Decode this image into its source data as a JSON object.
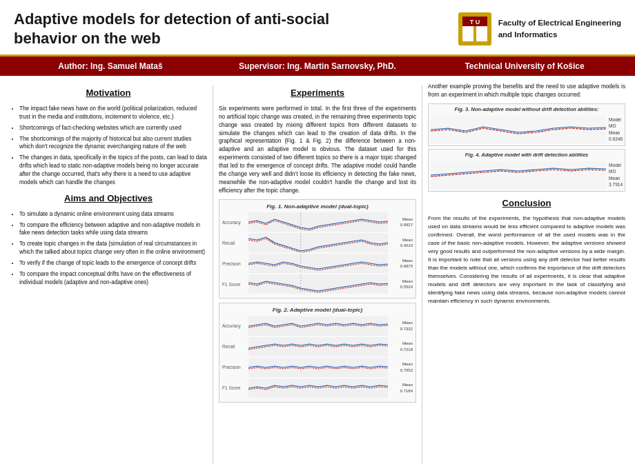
{
  "header": {
    "title_line1": "Adaptive models for detection of anti-social",
    "title_line2": "behavior on the web",
    "logo_text_line1": "Faculty of Electrical Engineering",
    "logo_text_line2": "and Informatics"
  },
  "author_bar": {
    "author": "Author: Ing. Samuel Mataš",
    "supervisor": "Supervisor: Ing. Martin Sarnovsky, PhD.",
    "university": "Technical University of Košice"
  },
  "col1": {
    "motivation_title": "Motivation",
    "motivation_bullets": [
      "The impact fake news have on the world (political polarization, reduced trust in the media and institutions, incitement to violence, etc.)",
      "Shortcomings of fact-checking websites which are currently used",
      "The shortcomings of the majority of historical but also current studies which don't recognize the dynamic everchanging nature of the web",
      "The changes in data, specifically in the topics of the posts, can lead to data drifts which lead to static non-adaptive models being no longer accurate after the change occurred, that's why there is a need to use adaptive models which can handle the changes"
    ],
    "aims_title": "Aims and Objectives",
    "aims_bullets": [
      "To simulate a dynamic online environment using data streams",
      "To compare the efficiency between adaptive and non-adaptive models in fake news detection tasks while using data streams",
      "To create topic changes in the data (simulation of real circumstances in which the talked about topics change very often in the online environment)",
      "To verify if the change of topic leads to the emergence of concept drifts",
      "To compare the impact conceptual drifts have on the effectiveness of individual models (adaptive and non-adaptive ones)"
    ]
  },
  "col2": {
    "experiments_title": "Experiments",
    "experiments_text": "Six experiments were performed in total. In the first three of the experiments no artificial topic change was created, in the remaining three experiments topic change was created by mixing different topics from different datasets to simulate the changes which can lead to the creation of data drifts. In the graphical representation (Fig. 1 & Fig. 2) the difference between a non-adaptive and an adaptive model is obvious. The dataset used for this experiments consisted of two different topics so there is a major topic changed that led to the emergence of concept drifts. The adaptive model could handle the change very well and didn't loose its efficiency in detecting the fake news, meanwhile the non-adaptive model couldn't handle the change and lost its efficiency after the topic change.",
    "fig1_title": "Fig. 1. Non-adaptive model (dual-topic)",
    "fig2_title": "Fig. 2. Adaptive model (dual-topic)",
    "fig1_metrics": [
      "Accuracy",
      "Recall",
      "Precision",
      "F1 Score"
    ],
    "fig1_means": [
      "0.6927",
      "0.4010",
      "0.6875",
      "0.5524"
    ],
    "fig2_means": [
      "0.7332",
      "0.7218",
      "0.7052",
      "0.7184"
    ]
  },
  "col3": {
    "intro_text": "Another example proving the benefits and the need to use adaptive models is from an experiment in which multiple topic changes occurred:",
    "fig3_title": "Fig. 3. Non-adaptive model without drift detection abilities:",
    "fig3_mean": "0.6246",
    "fig4_title": "Fig. 4. Adaptive model with drift detection abilities",
    "fig4_mean": "3.7914",
    "conclusion_title": "Conclusion",
    "conclusion_text": "From the results of the experiments, the hypothesis that non-adaptive models used on data streams would be less efficient compared to adaptive models was confirmed. Overall, the worst performance of all the used models was in the case of the basic non-adaptive models. However, the adaptive versions showed very good results and outperformed the non-adaptive versions by a wide margin. It is important to note that all versions using any drift detector had better results than the models without one, which confirms the importance of the drift detectors themselves. Considering the results of all experiments, it is clear that adaptive models and drift detectors are very important in the task of classifying and identifying fake news using data streams, because non-adaptive models cannot maintain efficiency in such dynamic environments."
  }
}
